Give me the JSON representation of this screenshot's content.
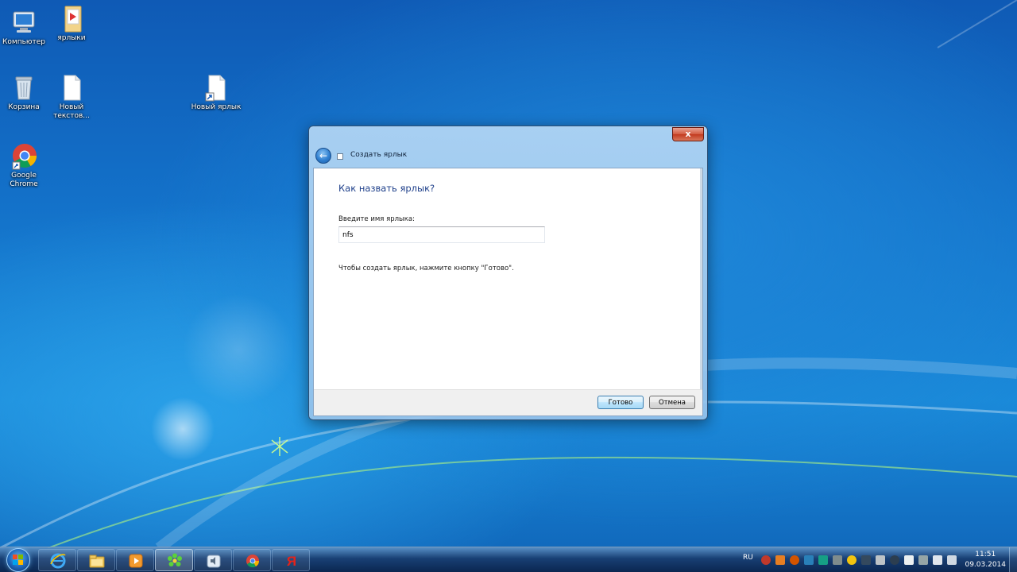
{
  "desktop": {
    "icons": [
      {
        "label": "Компьютер",
        "icon": "computer-icon"
      },
      {
        "label": "ярлыки",
        "icon": "folder-icon"
      },
      {
        "label": "Корзина",
        "icon": "recycle-bin-icon"
      },
      {
        "label": "Новый текстов...",
        "icon": "text-document-icon"
      },
      {
        "label": "Новый ярлык",
        "icon": "shortcut-icon"
      },
      {
        "label": "Google Chrome",
        "icon": "chrome-icon"
      }
    ]
  },
  "dialog": {
    "close_label": "x",
    "title": "Создать ярлык",
    "heading": "Как назвать ярлык?",
    "field_label": "Введите имя ярлыка:",
    "field_value": "nfs",
    "hint": "Чтобы создать ярлык, нажмите кнопку \"Готово\".",
    "finish_label": "Готово",
    "cancel_label": "Отмена"
  },
  "taskbar": {
    "pinned": [
      {
        "name": "internet-explorer",
        "icon": "ie-icon"
      },
      {
        "name": "explorer",
        "icon": "folder-icon"
      },
      {
        "name": "media-player",
        "icon": "media-player-icon"
      },
      {
        "name": "icq",
        "icon": "icq-flower-icon"
      },
      {
        "name": "speaker",
        "icon": "audio-app-icon"
      },
      {
        "name": "chrome",
        "icon": "chrome-icon"
      },
      {
        "name": "yandex",
        "icon": "yandex-icon"
      }
    ],
    "active_item": "icq",
    "language": "RU",
    "time": "11:51",
    "date": "09.03.2014"
  }
}
